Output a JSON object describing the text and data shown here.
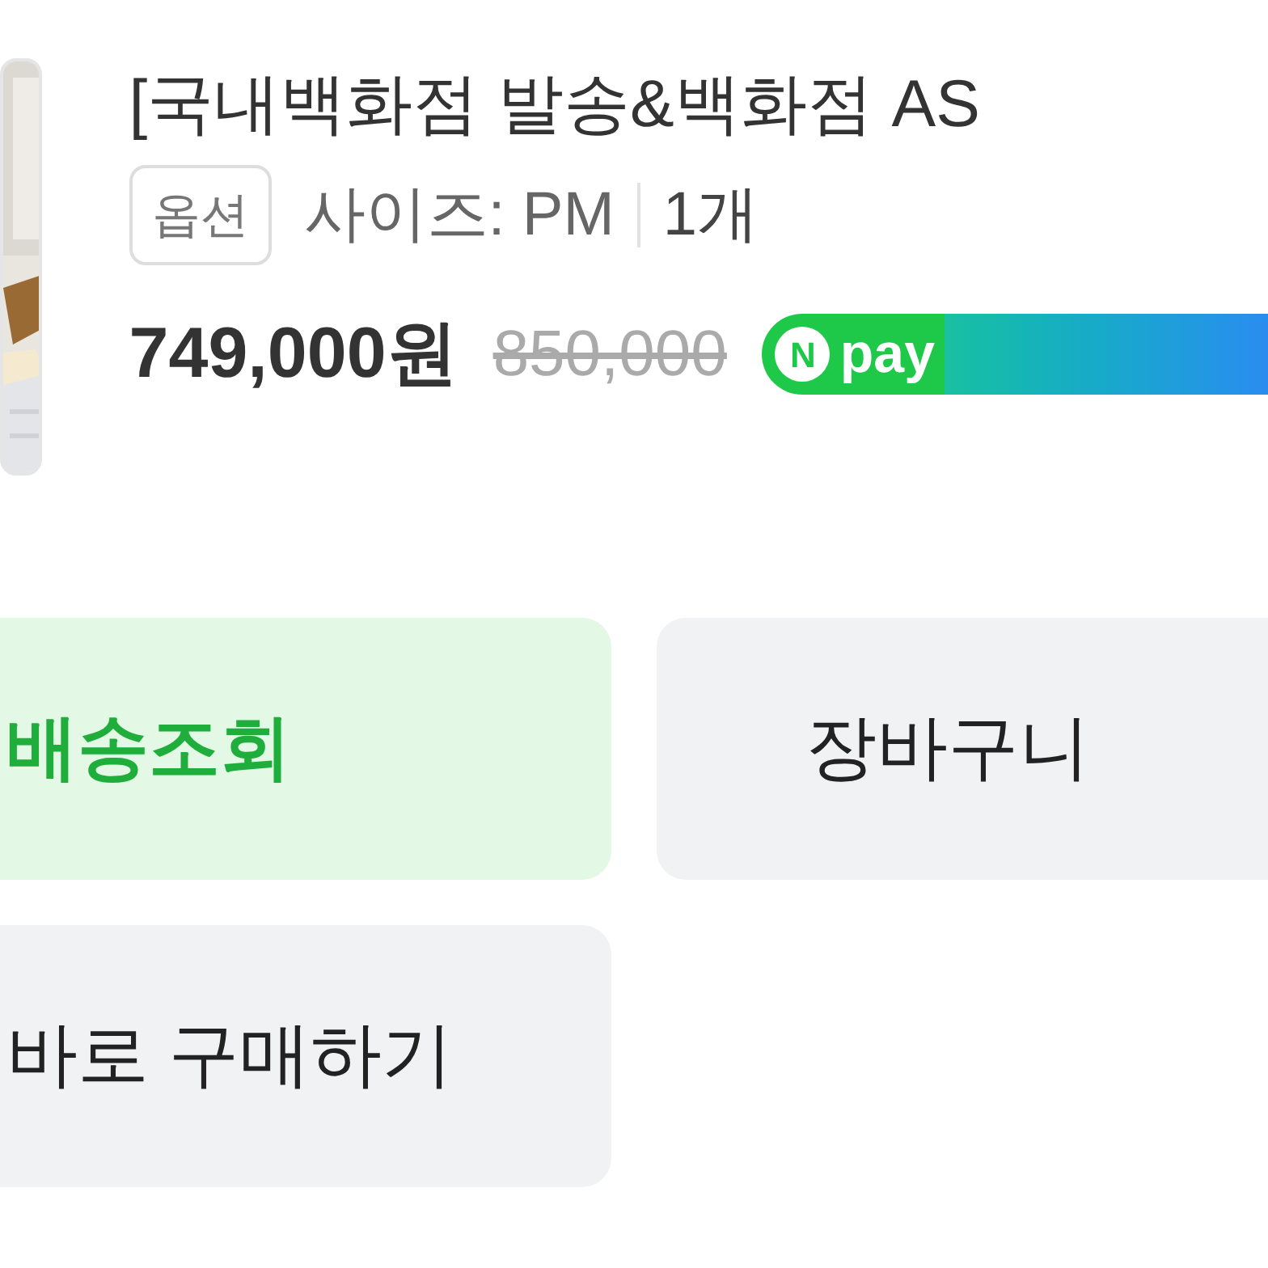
{
  "product": {
    "title": "[국내백화점 발송&백화점 AS",
    "option_tag": "옵션",
    "option": "사이즈: PM",
    "quantity": "1개",
    "price": "749,000원",
    "original_price": "850,000",
    "badge": {
      "mark": "N",
      "label": "pay"
    }
  },
  "buttons": [
    {
      "label": "배송조회",
      "kind": "primary"
    },
    {
      "label": "장바구니",
      "kind": "secondary"
    },
    {
      "label": "바로 구매하기",
      "kind": "secondary"
    }
  ]
}
